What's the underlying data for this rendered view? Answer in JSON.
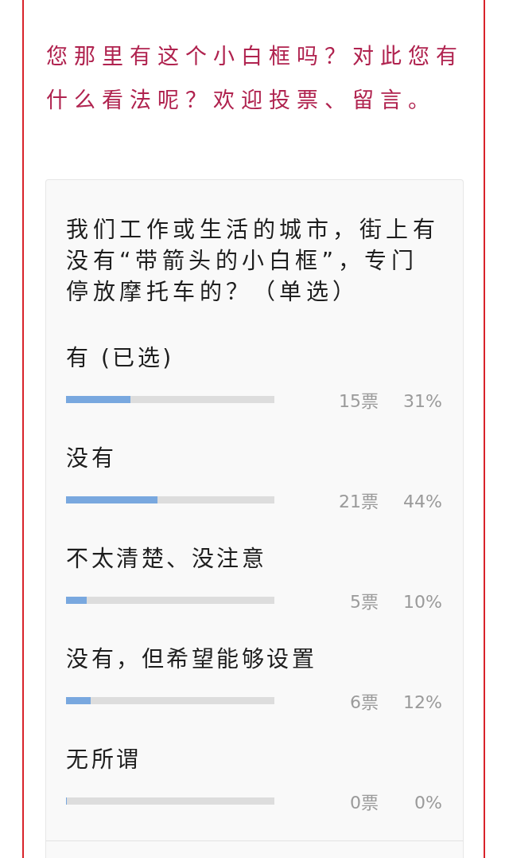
{
  "intro": {
    "text": "您那里有这个小白框吗？对此您有什么看法呢？欢迎投票、留言。"
  },
  "poll": {
    "question": "我们工作或生活的城市，街上有没有“带箭头的小白框”，专门停放摩托车的？（单选）",
    "options": [
      {
        "label": "有 (已选)",
        "level": 0.31,
        "votes": "15票",
        "percent": "31%"
      },
      {
        "label": "没有",
        "level": 0.44,
        "votes": "21票",
        "percent": "44%"
      },
      {
        "label": "不太清楚、没注意",
        "level": 0.1,
        "votes": "5票",
        "percent": "10%"
      },
      {
        "label": "没有，但希望能够设置",
        "level": 0.12,
        "votes": "6票",
        "percent": "12%"
      },
      {
        "label": "无所谓",
        "level": 0,
        "votes": "0票",
        "percent": "0%"
      }
    ]
  }
}
